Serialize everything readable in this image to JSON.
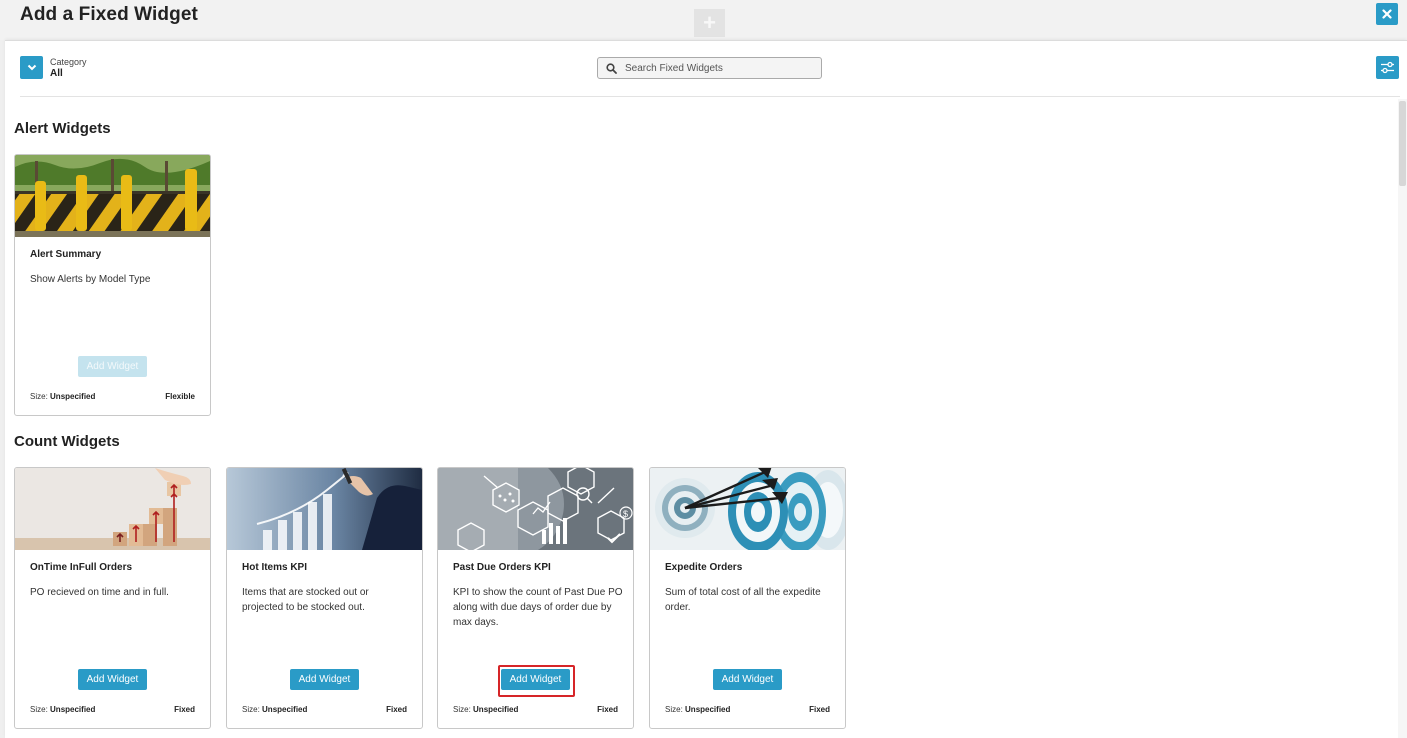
{
  "header": {
    "title": "Add a Fixed Widget"
  },
  "toolbar": {
    "category_label": "Category",
    "category_value": "All",
    "search_placeholder": "Search Fixed Widgets"
  },
  "sections": [
    {
      "title": "Alert Widgets",
      "cards": [
        {
          "title": "Alert Summary",
          "description": "Show Alerts by Model Type",
          "button": "Add Widget",
          "button_enabled": false,
          "size_label": "Size:",
          "size_value": "Unspecified",
          "type": "Flexible"
        }
      ]
    },
    {
      "title": "Count Widgets",
      "cards": [
        {
          "title": "OnTime InFull Orders",
          "description": "PO recieved on time and in full.",
          "button": "Add Widget",
          "button_enabled": true,
          "size_label": "Size:",
          "size_value": "Unspecified",
          "type": "Fixed"
        },
        {
          "title": "Hot Items KPI",
          "description": "Items that are stocked out or projected to be stocked out.",
          "button": "Add Widget",
          "button_enabled": true,
          "size_label": "Size:",
          "size_value": "Unspecified",
          "type": "Fixed"
        },
        {
          "title": "Past Due Orders KPI",
          "description": "KPI to show the count of Past Due PO along with due days of order due by max days.",
          "button": "Add Widget",
          "button_enabled": true,
          "highlighted": true,
          "size_label": "Size:",
          "size_value": "Unspecified",
          "type": "Fixed"
        },
        {
          "title": "Expedite Orders",
          "description": "Sum of total cost of all the expedite order.",
          "button": "Add Widget",
          "button_enabled": true,
          "size_label": "Size:",
          "size_value": "Unspecified",
          "type": "Fixed"
        }
      ]
    }
  ],
  "colors": {
    "accent": "#2a9bc7",
    "highlight": "#d62528"
  },
  "icons": [
    "close-icon",
    "plus-icon",
    "chevron-down-icon",
    "search-icon",
    "filter-settings-icon"
  ]
}
